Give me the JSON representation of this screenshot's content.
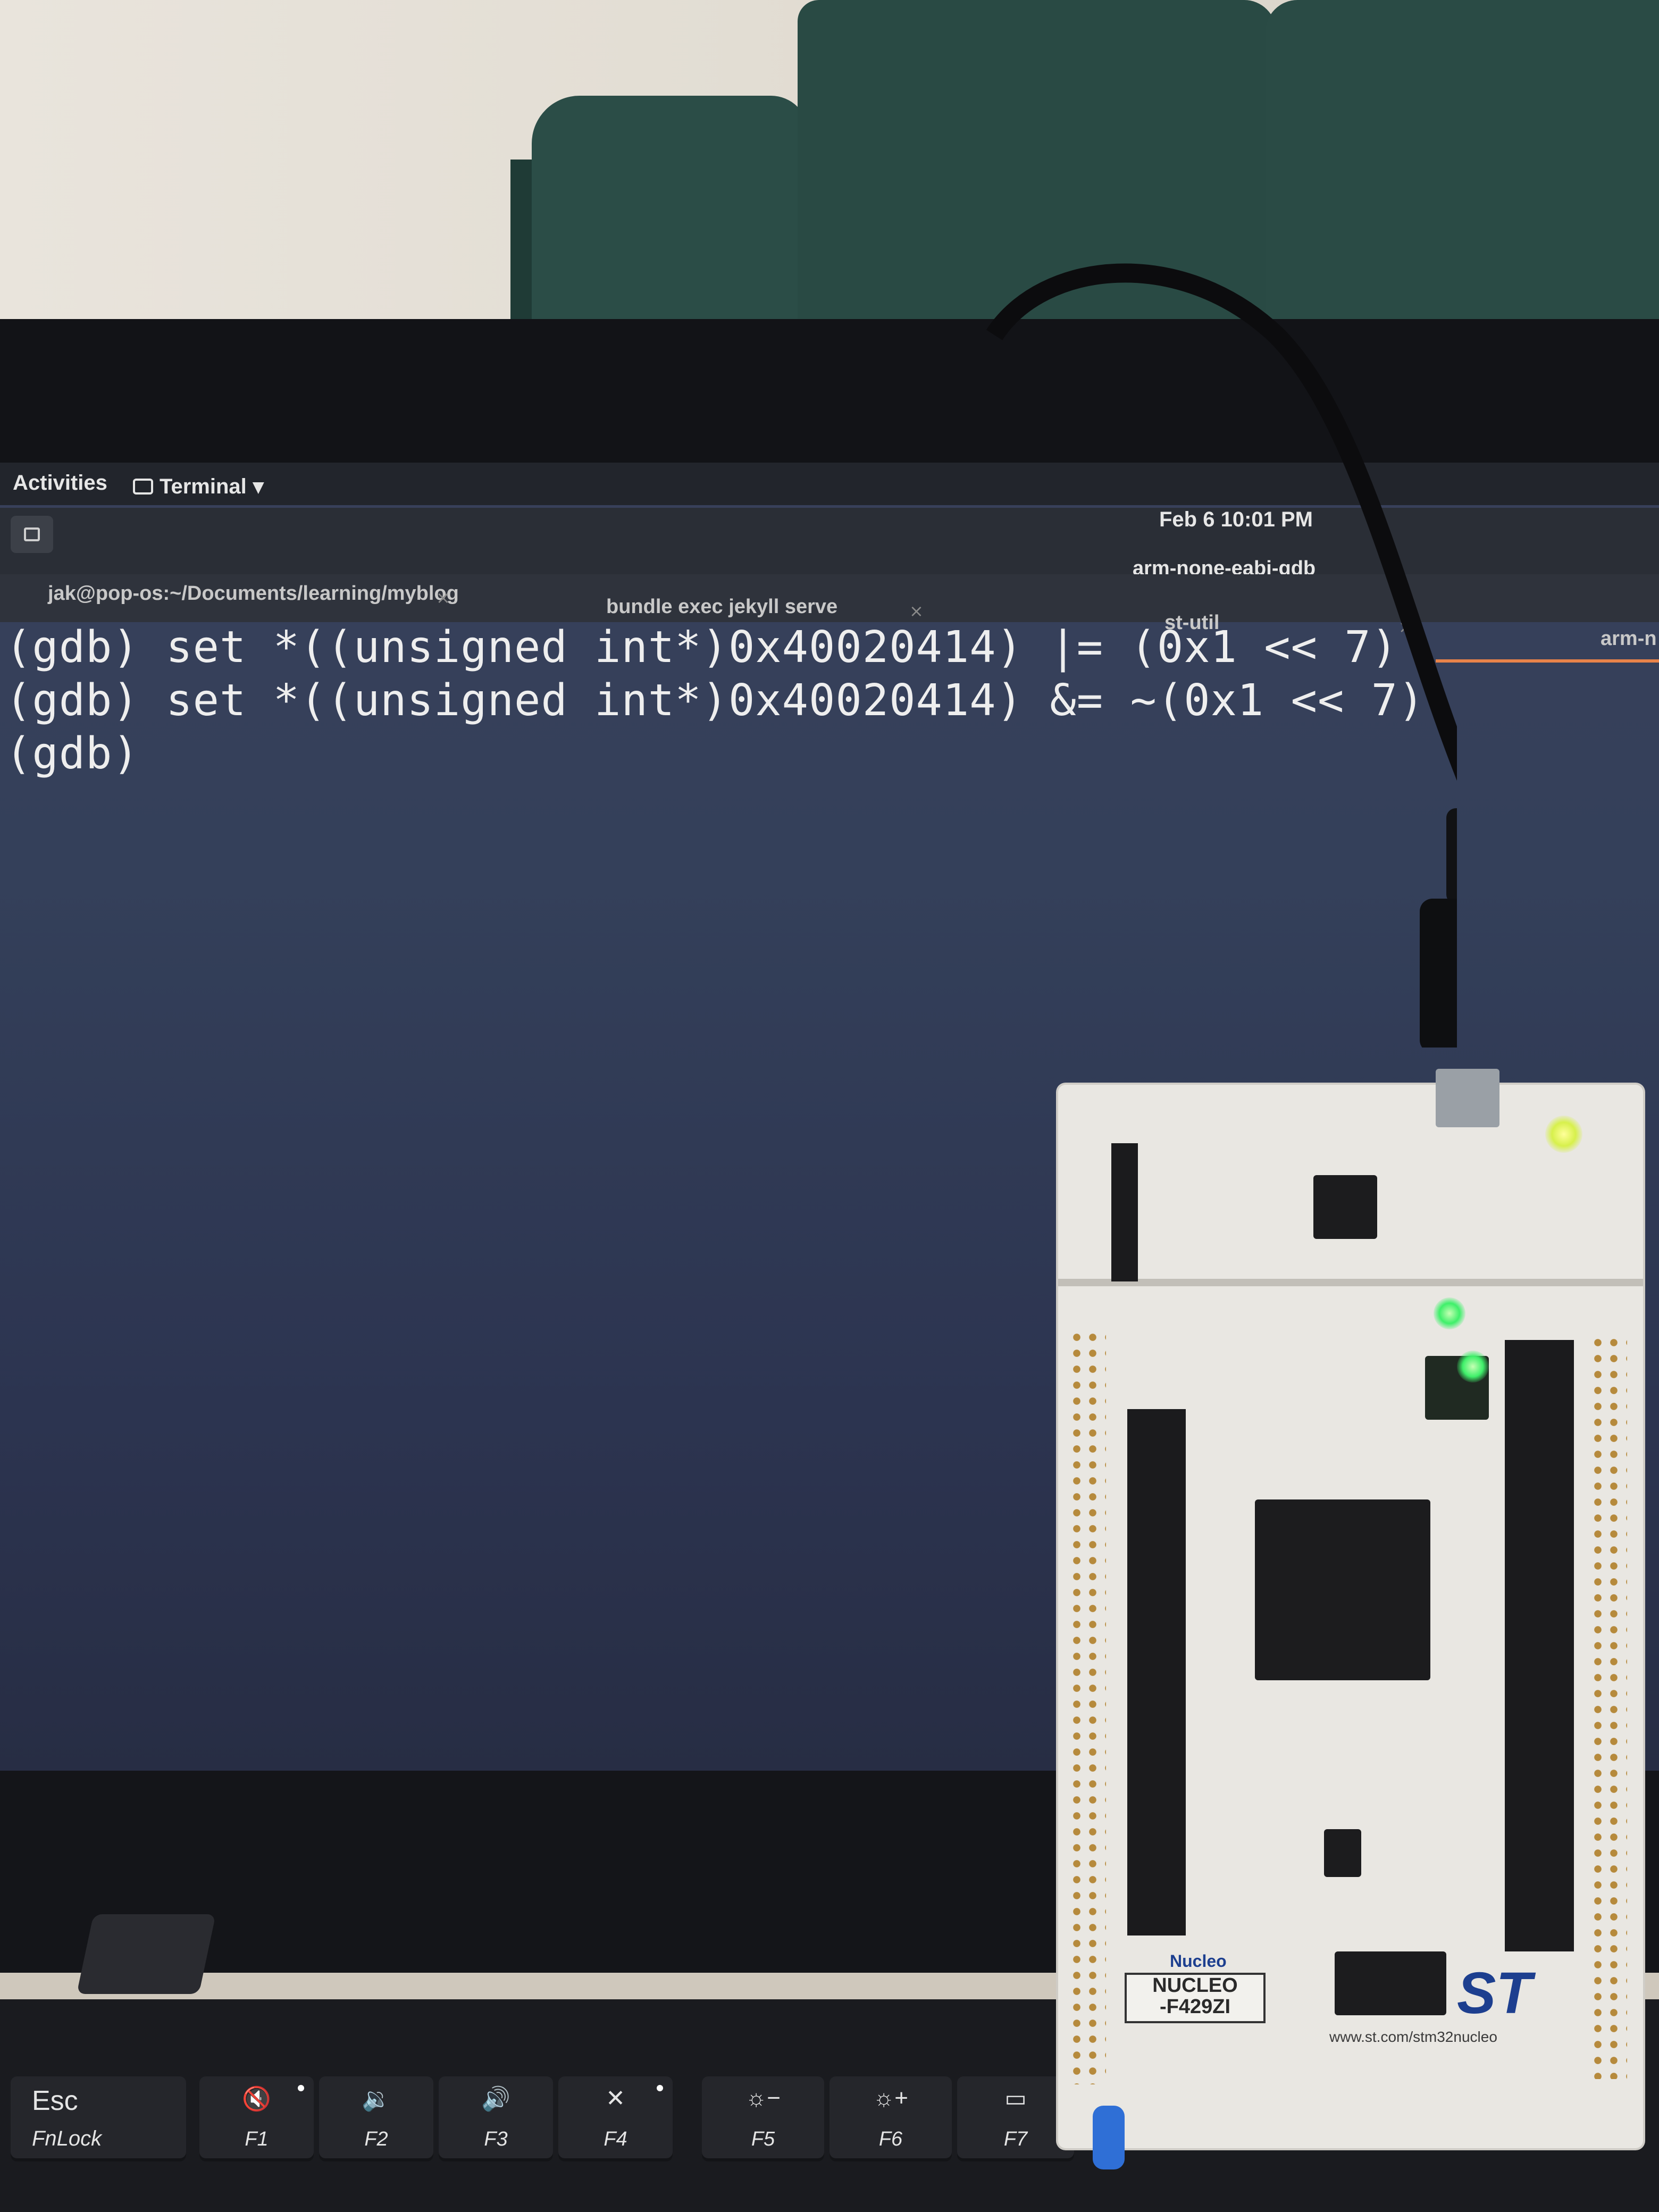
{
  "topbar": {
    "activities": "Activities",
    "app_menu": "Terminal",
    "datetime": "Feb 6  10:01 PM"
  },
  "headerbar": {
    "window_title": "arm-none-eabi-gdb"
  },
  "tabs": [
    {
      "label": "jak@pop-os:~/Documents/learning/myblog"
    },
    {
      "label": "bundle exec jekyll serve"
    },
    {
      "label": "st-util"
    },
    {
      "label": "arm-n"
    }
  ],
  "tab_close_glyph": "×",
  "terminal": {
    "lines": [
      "(gdb) set *((unsigned int*)0x40020414) |= (0x1 << 7)",
      "(gdb) set *((unsigned int*)0x40020414) &= ~(0x1 << 7)",
      "(gdb)"
    ]
  },
  "board": {
    "label_line1": "NUCLEO",
    "label_line2": "-F429ZI",
    "nucleo_text": "Nucleo",
    "st_logo": "ST",
    "url": "www.st.com/stm32nucleo"
  },
  "keyboard": {
    "esc": {
      "top": "Esc",
      "bottom": "FnLock"
    },
    "f1": {
      "icon": "mute-icon",
      "label": "F1"
    },
    "f2": {
      "icon": "volume-down-icon",
      "label": "F2"
    },
    "f3": {
      "icon": "volume-up-icon",
      "label": "F3"
    },
    "f4": {
      "icon": "mic-mute-icon",
      "label": "F4"
    },
    "f5": {
      "icon": "brightness-down-icon",
      "label": "F5"
    },
    "f6": {
      "icon": "brightness-up-icon",
      "label": "F6"
    },
    "f7": {
      "icon": "display-icon",
      "label": "F7"
    }
  },
  "colors": {
    "terminal_bg": "#34405a",
    "terminal_text": "#eeeeee",
    "active_tab_accent": "#e8834a",
    "board_led_yellow": "#d7f04c",
    "board_led_green": "#3ff06a"
  }
}
